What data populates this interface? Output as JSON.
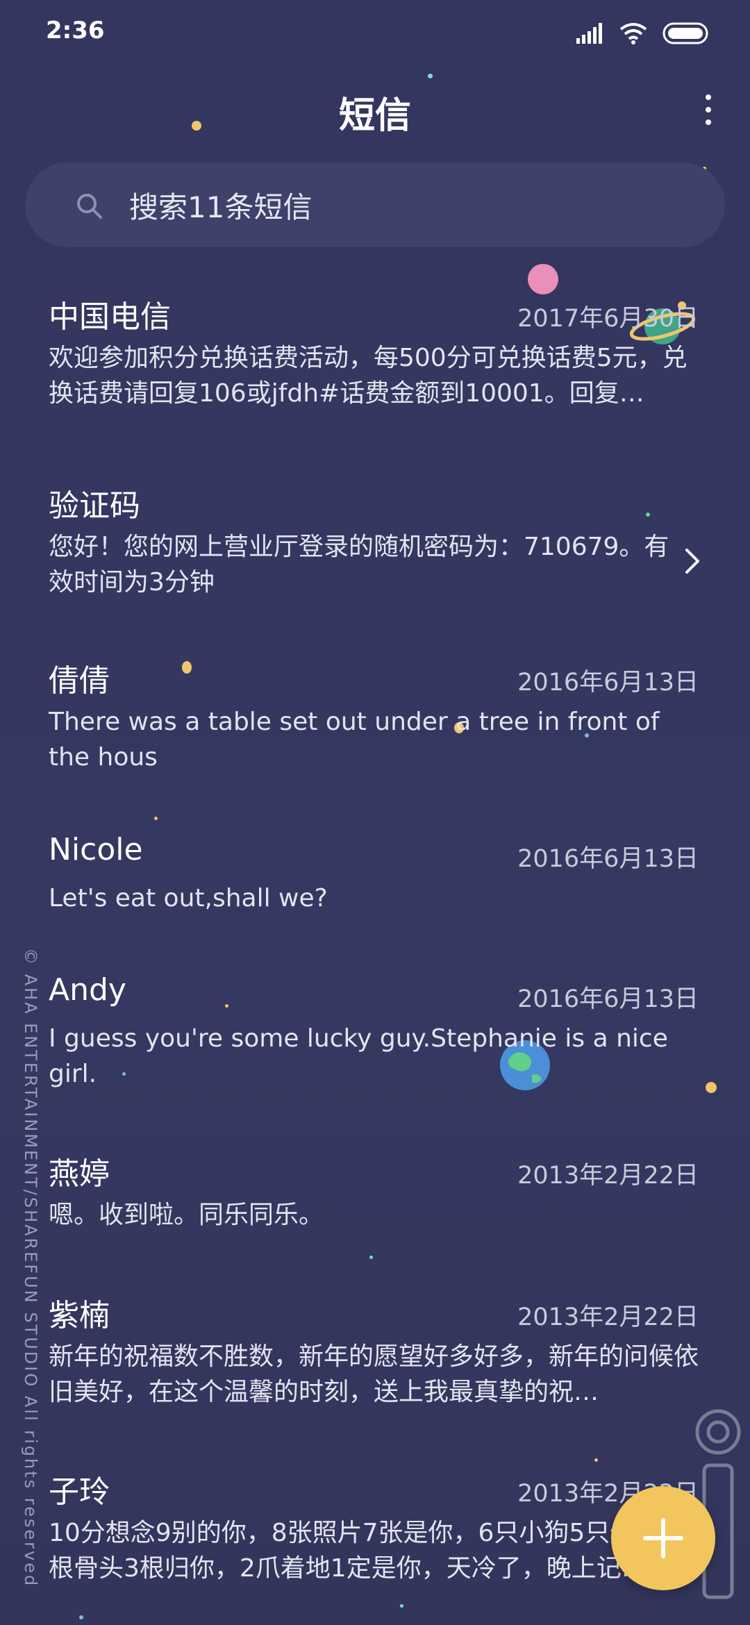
{
  "status_bar": {
    "time": "2:36"
  },
  "header": {
    "title": "短信"
  },
  "search": {
    "placeholder": "搜索11条短信"
  },
  "messages": [
    {
      "name": "中国电信",
      "date": "2017年6月30日",
      "preview": "欢迎参加积分兑换话费活动，每500分可兑换话费5元，兑换话费请回复106或jfdh#话费金额到10001。回复…"
    },
    {
      "name": "验证码",
      "date": "",
      "preview": "您好！您的网上营业厅登录的随机密码为：710679。有效时间为3分钟"
    },
    {
      "name": "倩倩",
      "date": "2016年6月13日",
      "preview": "There was a table set out under a tree in front of the hous"
    },
    {
      "name": "Nicole",
      "date": "2016年6月13日",
      "preview": "Let's eat out,shall we?"
    },
    {
      "name": "Andy",
      "date": "2016年6月13日",
      "preview": "I guess you're some lucky guy.Stephanie is a nice girl."
    },
    {
      "name": "燕婷",
      "date": "2013年2月22日",
      "preview": "嗯。收到啦。同乐同乐。"
    },
    {
      "name": "紫楠",
      "date": "2013年2月22日",
      "preview": "新年的祝福数不胜数，新年的愿望好多好多，新年的问候依旧美好，在这个温馨的时刻，送上我最真挚的祝…"
    },
    {
      "name": "子玲",
      "date": "2013年2月22日",
      "preview": "10分想念9别的你，8张照片7张是你，6只小狗5只像你，4根骨头3根归你，2爪着地1定是你，天冷了，晚上记…"
    }
  ],
  "side_text": "© AHA ENTERTAINMENT/SHAREFUN STUDIO All rights reserved",
  "icons": {
    "search": "search-icon",
    "more": "more-vertical-icon",
    "chevron": "chevron-right-icon",
    "compose": "plus-icon",
    "signal": "signal-icon",
    "wifi": "wifi-icon",
    "battery": "battery-icon"
  },
  "colors": {
    "background": "#34365f",
    "search_bg": "#3e4169",
    "fab": "#f2c65c",
    "secondary_text": "#c9cadb"
  }
}
